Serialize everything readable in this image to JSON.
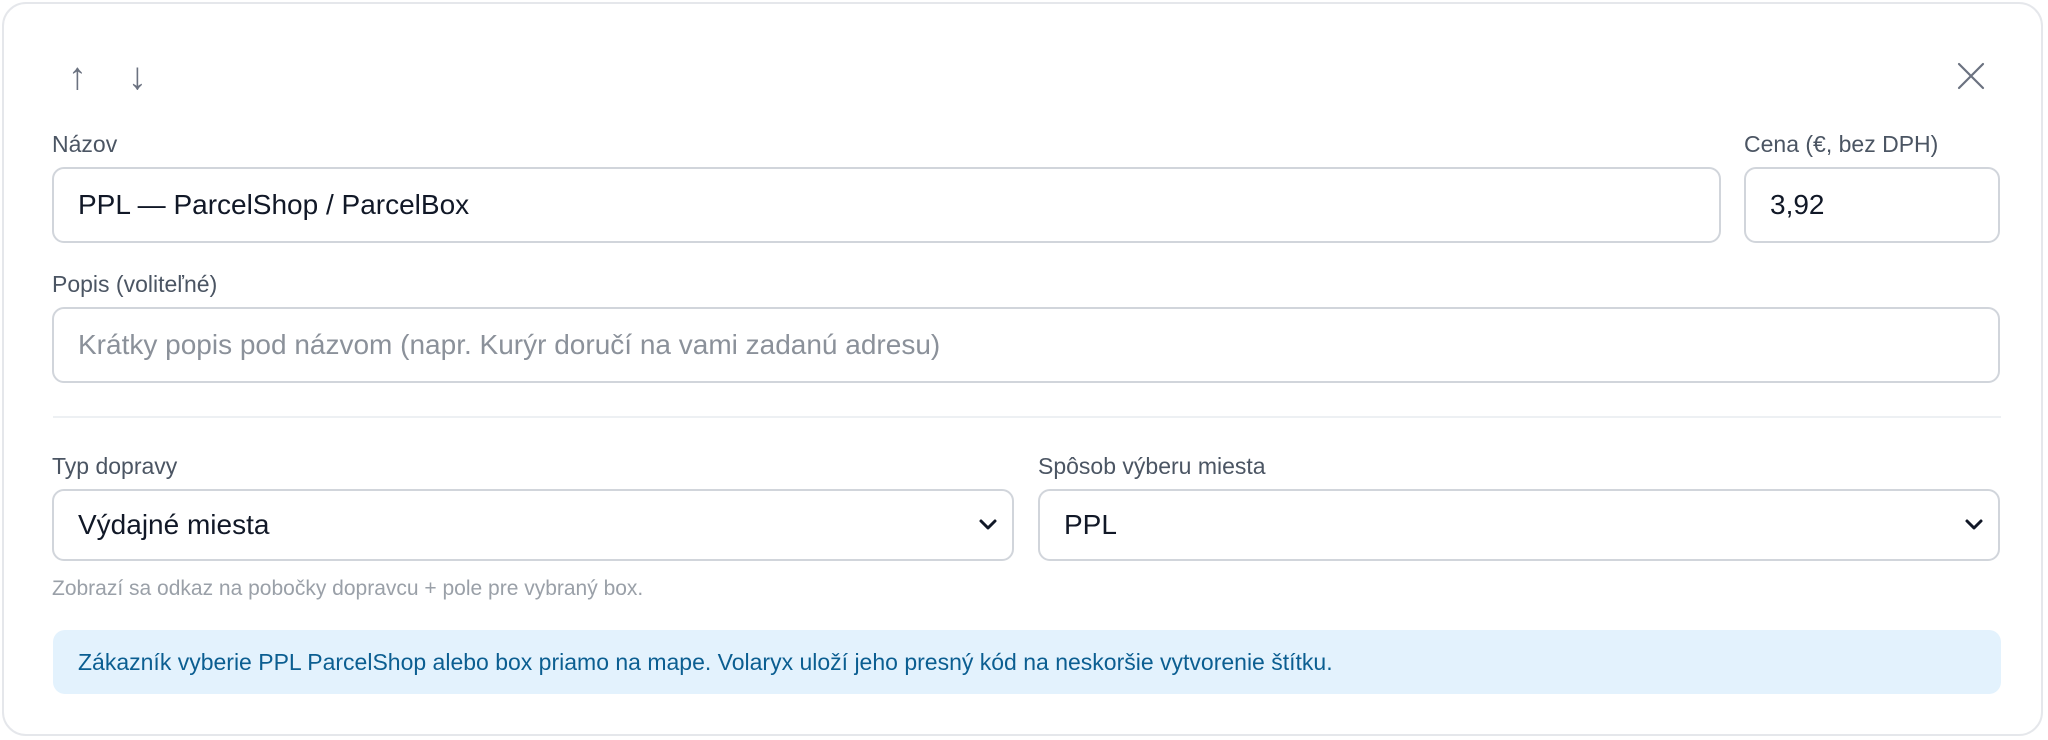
{
  "toolbar": {
    "move_up_icon": "arrow-up-icon",
    "move_down_icon": "arrow-down-icon",
    "close_icon": "close-icon",
    "up_glyph": "↑",
    "down_glyph": "↓"
  },
  "form": {
    "name": {
      "label": "Názov",
      "value": "PPL — ParcelShop / ParcelBox"
    },
    "price": {
      "label": "Cena (€, bez DPH)",
      "value": "3,92"
    },
    "description": {
      "label": "Popis (voliteľné)",
      "value": "",
      "placeholder": "Krátky popis pod názvom (napr. Kurýr doručí na vami zadanú adresu)"
    },
    "shipping_type": {
      "label": "Typ dopravy",
      "selected": "Výdajné miesta"
    },
    "pickup_method": {
      "label": "Spôsob výberu miesta",
      "selected": "PPL"
    },
    "hint": "Zobrazí sa odkaz na pobočky dopravcu + pole pre vybraný box.",
    "info": "Zákazník vyberie PPL ParcelShop alebo box priamo na mape. Volaryx uloží jeho presný kód na neskoršie vytvorenie štítku."
  },
  "colors": {
    "border": "#d1d5db",
    "info_bg": "#e3f2fd",
    "info_text": "#0b5e91",
    "muted_text": "#9aa0a8"
  }
}
